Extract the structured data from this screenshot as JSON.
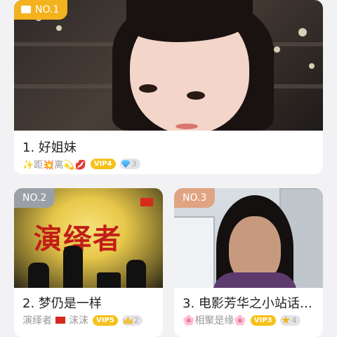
{
  "cards": [
    {
      "rank_badge": "NO.1",
      "title": "1. 好姐妹",
      "meta": {
        "prefix": "✨距💥离💫💋",
        "vip": "VIP4",
        "level": "3"
      }
    },
    {
      "rank_badge": "NO.2",
      "cover_text": "演绎者",
      "title": "2. 梦仍是一样",
      "meta": {
        "prefix": "演绎者",
        "suffix": "沫沫",
        "vip": "VIP5",
        "level": "2"
      }
    },
    {
      "rank_badge": "NO.3",
      "title": "3. 电影芳华之小站话…",
      "meta": {
        "prefix": "🌸相聚是缘🌸",
        "vip": "VIP3",
        "level": "4"
      }
    }
  ],
  "colors": {
    "gold": "#f3b21e",
    "silver": "#9aa0a8",
    "bronze": "#e0a483",
    "vip": "#f5c11a"
  }
}
